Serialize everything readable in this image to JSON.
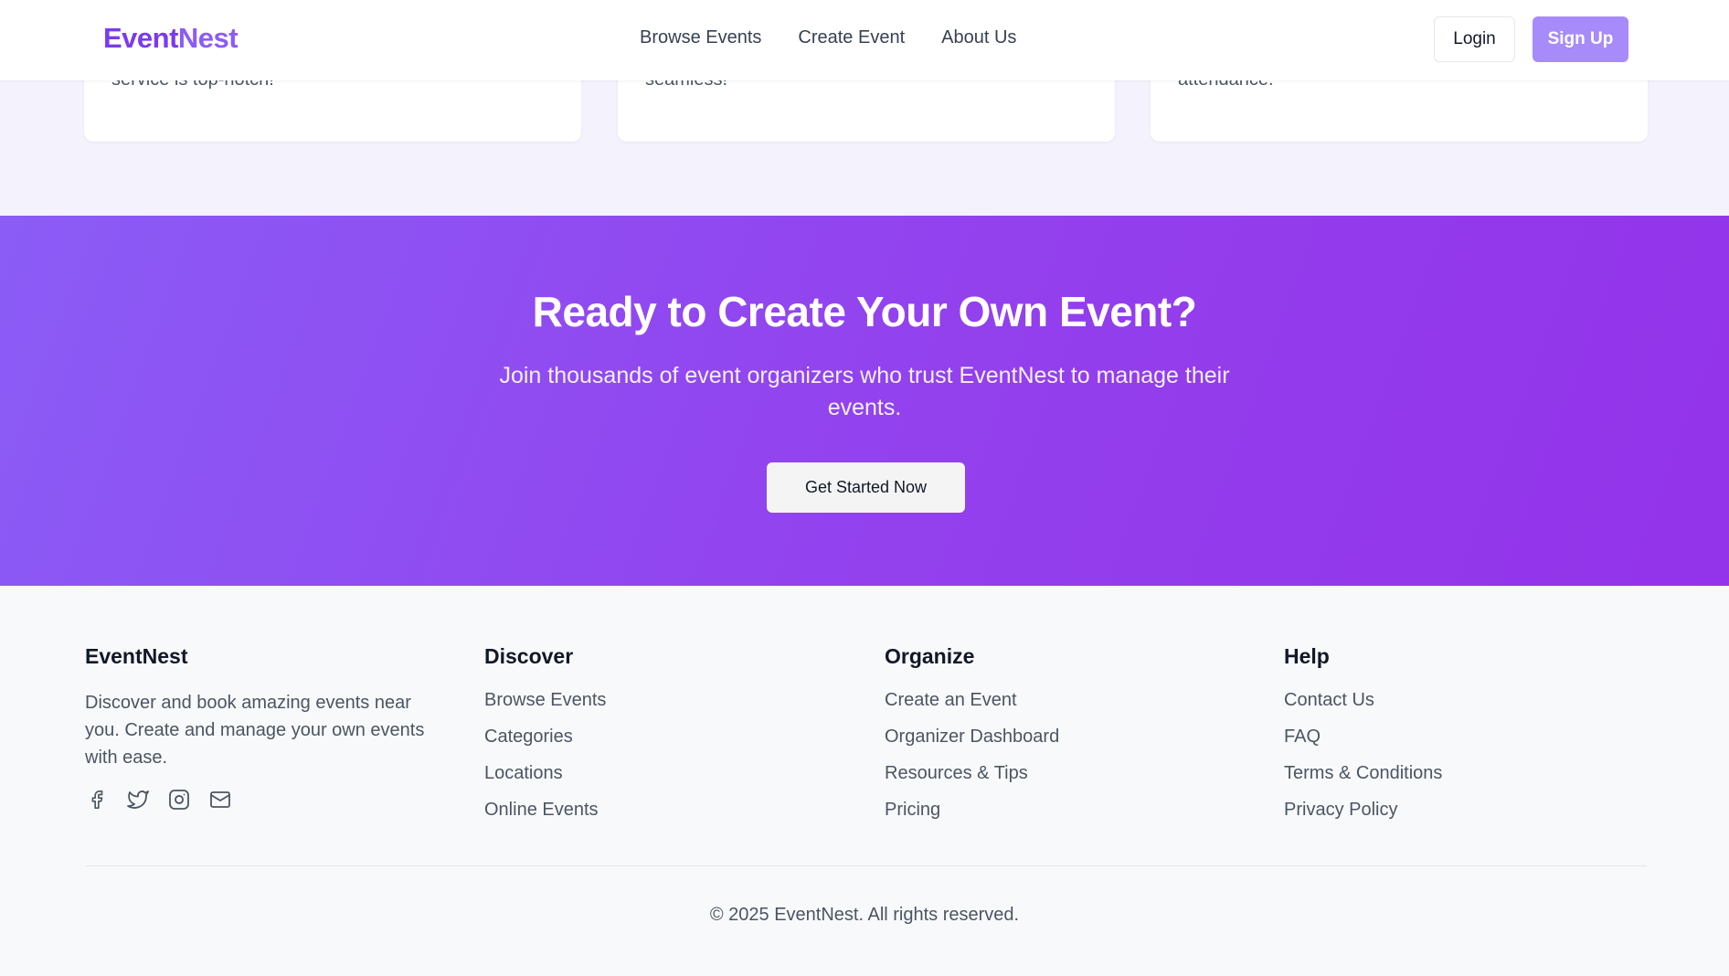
{
  "header": {
    "logo_part1": "Event",
    "logo_part2": "Nest",
    "nav": [
      "Browse Events",
      "Create Event",
      "About Us"
    ],
    "login_label": "Login",
    "signup_label": "Sign Up"
  },
  "testimonials": [
    {
      "line_top": "service is top-notch!"
    },
    {
      "line_top": "seamless!"
    },
    {
      "line_top": "attendance."
    }
  ],
  "cta": {
    "title": "Ready to Create Your Own Event?",
    "subtitle": "Join thousands of event organizers who trust EventNest to manage their events.",
    "button_label": "Get Started Now"
  },
  "footer": {
    "brand": "EventNest",
    "description": "Discover and book amazing events near you. Create and manage your own events with ease.",
    "socials": [
      "facebook-icon",
      "twitter-icon",
      "instagram-icon",
      "mail-icon"
    ],
    "columns": [
      {
        "title": "Discover",
        "links": [
          "Browse Events",
          "Categories",
          "Locations",
          "Online Events"
        ]
      },
      {
        "title": "Organize",
        "links": [
          "Create an Event",
          "Organizer Dashboard",
          "Resources & Tips",
          "Pricing"
        ]
      },
      {
        "title": "Help",
        "links": [
          "Contact Us",
          "FAQ",
          "Terms & Conditions",
          "Privacy Policy"
        ]
      }
    ],
    "copyright": "© 2025 EventNest. All rights reserved."
  },
  "colors": {
    "brand": "#7c3aed",
    "signup_button": "#a78bfa",
    "cta_gradient_start": "#8b5cf6",
    "cta_gradient_end": "#9333ea"
  }
}
